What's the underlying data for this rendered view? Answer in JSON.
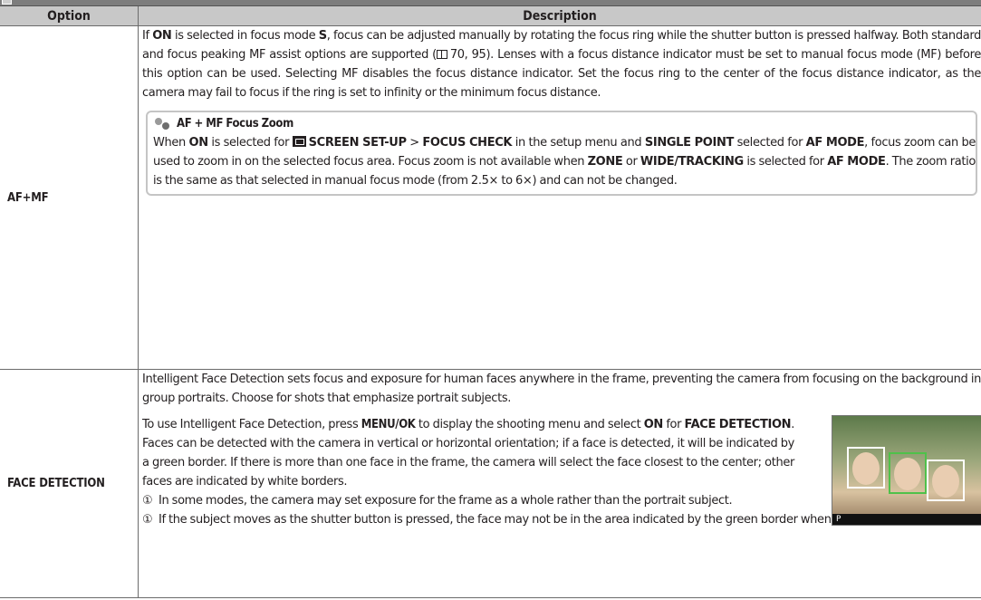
{
  "table": {
    "col_option": "Option",
    "col_description": "Description"
  },
  "afmf": {
    "option": "AF+MF",
    "d_pre": "If ",
    "d_on": "ON",
    "d_mid1": " is selected in focus mode ",
    "d_s": "S",
    "d_mid2": ", focus can be adjusted manually by rotating the focus ring while the shutter button is pressed halfway. Both standard and focus peaking MF assist options are supported (",
    "d_ref": "70, 95",
    "d_post": "). Lenses with a focus distance indicator must be set to manual focus mode (MF) before this option can be used. Selecting MF disables the focus distance indicator. Set the focus ring to the center of the focus distance indicator, as the camera may fail to focus if the ring is set to infinity or the minimum focus distance.",
    "note_icon": "note-icon",
    "note_title": "AF + MF Focus Zoom",
    "n_pre": "When ",
    "n_on": "ON",
    "n_mid1": " is selected for ",
    "n_screen": "SCREEN SET-UP",
    "n_gt": " > ",
    "n_focuscheck": "FOCUS CHECK",
    "n_mid2": " in the setup menu and ",
    "n_single": "SINGLE POINT",
    "n_mid3": " selected for ",
    "n_afmode1": "AF MODE",
    "n_mid4": ", focus zoom can be used to zoom in on the selected focus area. Focus zoom is not available when ",
    "n_zone": "ZONE",
    "n_or": " or ",
    "n_wide": "WIDE/TRACKING",
    "n_mid5": " is selected for ",
    "n_afmode2": "AF MODE",
    "n_end": ". The zoom ratio is the same as that selected in manual focus mode (from 2.5× to 6×) and can not be changed."
  },
  "fd": {
    "option": "FACE DETECTION",
    "intro": "Intelligent Face Detection sets focus and exposure for human faces anywhere in the frame, preventing the camera from focusing on the background in group portraits. Choose for shots that emphasize portrait subjects.",
    "p_pre": "To use Intelligent Face Detection, press ",
    "p_menu": "MENU/OK",
    "p_mid1": " to display the shooting menu and select ",
    "p_on": "ON",
    "p_mid2": " for ",
    "p_fd": "FACE DETECTION",
    "p_end": ". Faces can be detected with the camera in vertical or horizontal orientation; if a face is detected, it will be indicated by a green border. If there is more than one face in the frame, the camera will select the face closest to the center; other faces are indicated by white borders.",
    "photo_mode": "P",
    "warn_mark": "①",
    "warn1": "In some modes, the camera may set exposure for the frame as a whole rather than the portrait subject.",
    "warn2": "If the subject moves as the shutter button is pressed, the face may not be in the area indicated by the green border when the picture is taken."
  },
  "colors": {
    "header_bg": "#c8c8c8",
    "rule": "#6b6b6b",
    "note_border": "#c5c5c5",
    "face_box_selected": "#4fc14a"
  }
}
